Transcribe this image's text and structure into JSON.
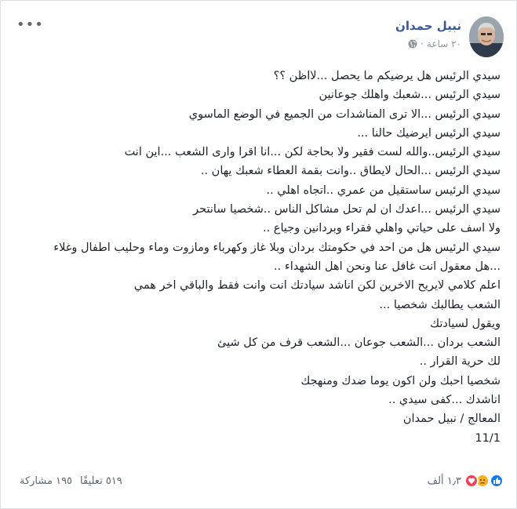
{
  "post": {
    "author": "نبيل حمدان",
    "time": "٢٠ ساعة",
    "separator": "·",
    "lines": [
      "سيدي الرئيس هل يرضيكم ما يحصل ...لااظن ؟؟",
      "سيدي الرئيس ...شعبك واهلك جوعانين",
      "سيدي الرئيس ...الا ترى المناشدات من الجميع في الوضع الماسوي",
      "سيدي الرئيس ايرضيك حالنا ...",
      "سيدي الرئيس..والله لست فقير ولا بحاجة لكن ...انا اقرا وارى الشعب ...اين انت",
      "سيدي الرئيس ...الحال لايطاق ..وانت بقمة العطاء شعبك يهان ..",
      "سيدي الرئيس ساستقيل من عمري ..اتجاه اهلي ..",
      "سيدي الرئيس ...اعدك ان لم تحل مشاكل الناس ..شخصيا سانتحر",
      "ولا اسف على حياتي واهلي فقراء وبردانين وجياع ..",
      "سيدي الرئيس هل من احد في حكومتك بردان وبلا غاز وكهرباء ومازوت وماء وحليب اطفال وغلاء",
      "...هل معقول انت غافل عنا ونحن اهل الشهداء ..",
      "اعلم كلامي لايريح الاخرين لكن اناشد سيادتك انت وانت فقط والباقي اخر همي",
      "الشعب يطالبك شخصيا ...",
      "ويقول لسيادتك",
      "الشعب بردان ...الشعب جوعان ...الشعب قرف من كل شيئ",
      "لك حرية القرار ..",
      "شخصيا احبك ولن اكون يوما ضدك ومنهجك",
      "اناشدك ...كفى سيدي ..",
      "المعالج / نبيل حمدان",
      "11/1"
    ]
  },
  "footer": {
    "reactions_count": "١٫٣ ألف",
    "comments": "٥١٩ تعليقًا",
    "shares": "١٩٥ مشاركة"
  },
  "icons": {
    "more": "more-dots-icon",
    "privacy": "globe-icon",
    "reactions": [
      "like-icon",
      "sad-icon",
      "love-icon"
    ]
  },
  "colors": {
    "author": "#385898",
    "meta": "#90949c",
    "text": "#1d2129",
    "like": "#1877f2",
    "love": "#f33e58",
    "sad": "#f7b125"
  }
}
